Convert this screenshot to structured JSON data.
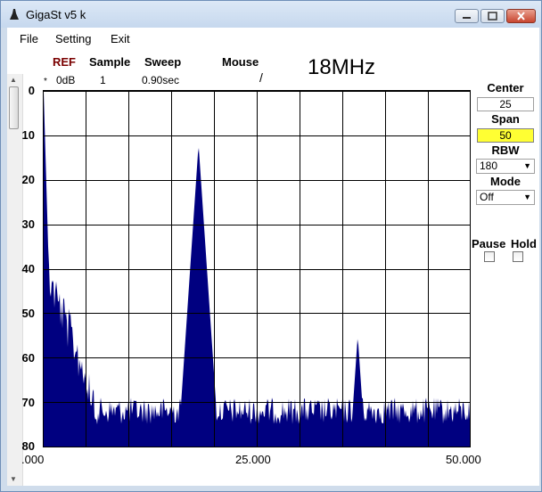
{
  "window": {
    "title": "GigaSt v5 k"
  },
  "menu": {
    "items": [
      "File",
      "Setting",
      "Exit"
    ]
  },
  "header": {
    "ref_label": "REF",
    "sample_label": "Sample",
    "sweep_label": "Sweep",
    "mouse_label": "Mouse",
    "ref_value": "0dB",
    "sample_value": "1",
    "sweep_value": "0.90sec",
    "mouse_value": "/",
    "frequency": "18MHz",
    "marker": "*"
  },
  "controls": {
    "center_label": "Center",
    "center_value": "25",
    "span_label": "Span",
    "span_value": "50",
    "rbw_label": "RBW",
    "rbw_value": "180",
    "mode_label": "Mode",
    "mode_value": "Off",
    "pause_label": "Pause",
    "hold_label": "Hold"
  },
  "colors": {
    "trace": "#000080",
    "grid": "#000000",
    "span_highlight": "#ffff33",
    "ref_label": "#7a0000"
  },
  "chart_data": {
    "type": "area",
    "y_ticks": [
      "0",
      "10",
      "20",
      "30",
      "40",
      "50",
      "60",
      "70",
      "80"
    ],
    "x_ticks": [
      ".000",
      "25.000",
      "50.000"
    ],
    "xlim": [
      0,
      50
    ],
    "ylim": [
      0,
      80
    ],
    "y_inverted": true,
    "grid": true,
    "noise_floor_db": 72,
    "peaks": [
      {
        "x": 0.1,
        "y": 0
      },
      {
        "x": 0.5,
        "y": 40
      },
      {
        "x": 1.5,
        "y": 46
      },
      {
        "x": 2.5,
        "y": 55
      },
      {
        "x": 5.0,
        "y": 66
      },
      {
        "x": 18.2,
        "y": 12
      },
      {
        "x": 36.8,
        "y": 55
      }
    ]
  }
}
